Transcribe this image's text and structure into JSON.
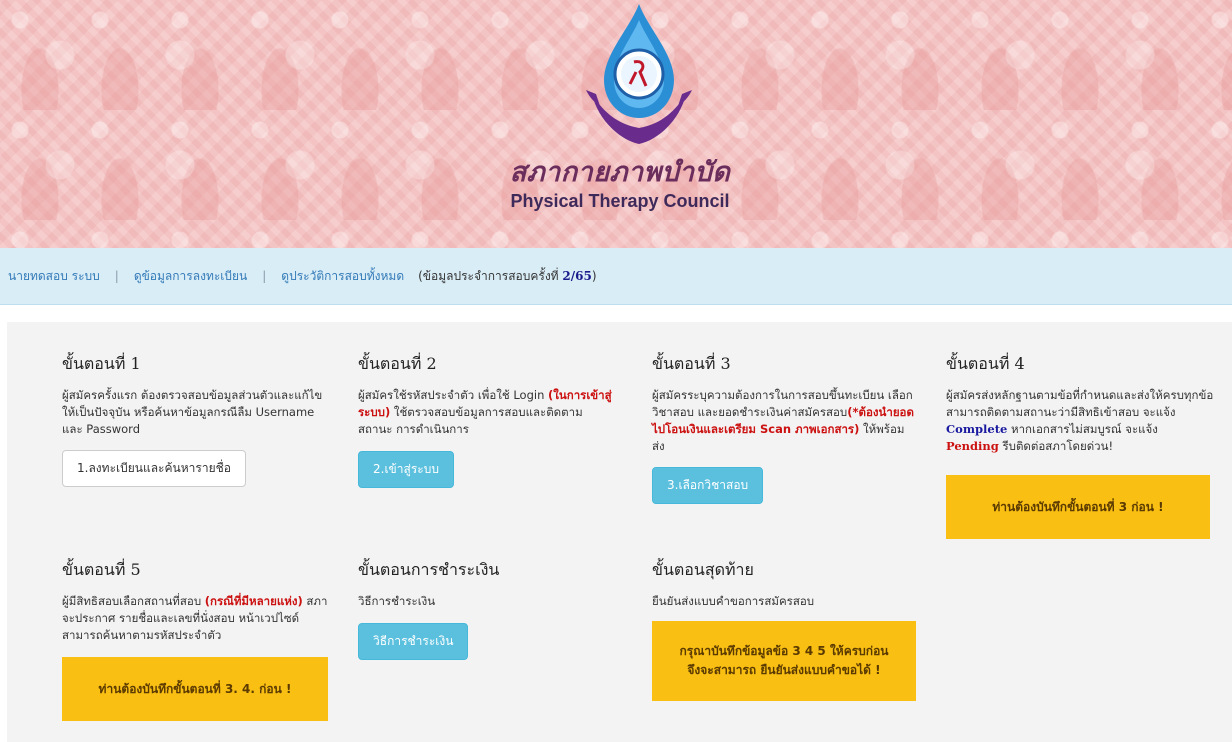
{
  "header": {
    "org_thai": "สภากายภาพบำบัด",
    "org_en": "Physical Therapy Council",
    "logo_text": "สภากายภาพบำบัด Physical Therapy Council"
  },
  "nav": {
    "items": [
      "นายทดสอบ ระบบ",
      "ดูข้อมูลการลงทะเบียน",
      "ดูประวัติการสอบทั้งหมด"
    ],
    "exam_info_prefix": "(ข้อมูลประจำการสอบครั้งที่",
    "exam_round": "2/65",
    "exam_info_suffix": ")"
  },
  "steps": {
    "s1": {
      "title": "ขั้นตอนที่ 1",
      "desc": "ผู้สมัครครั้งแรก ต้องตรวจสอบข้อมูลส่วนตัวและแก้ไขให้เป็นปัจจุบัน หรือค้นหาข้อมูลกรณีลืม Username และ Password",
      "button": "1.ลงทะเบียนและค้นหารายชื่อ"
    },
    "s2": {
      "title": "ขั้นตอนที่ 2",
      "desc_a": "ผู้สมัครใช้รหัสประจำตัว เพื่อใช้ Login ",
      "desc_red": "(ในการเข้าสู่ระบบ)",
      "desc_b": " ใช้ตรวจสอบข้อมูลการสอบและติดตามสถานะ การดำเนินการ",
      "button": "2.เข้าสู่ระบบ"
    },
    "s3": {
      "title": "ขั้นตอนที่ 3",
      "desc_a": "ผู้สมัครระบุความต้องการในการสอบขึ้นทะเบียน เลือกวิชาสอบ และยอดชำระเงินค่าสมัครสอบ",
      "desc_red": "(*ต้องนำยอดไปโอนเงินและเตรียม Scan ภาพเอกสาร)",
      "desc_b": " ให้พร้อมส่ง",
      "button": "3.เลือกวิชาสอบ"
    },
    "s4": {
      "title": "ขั้นตอนที่ 4",
      "desc_a": "ผู้สมัครส่งหลักฐานตามข้อที่กำหนดและส่งให้ครบทุกข้อ สามารถติดตามสถานะว่ามีสิทธิเข้าสอบ จะแจ้ง ",
      "desc_complete": "Complete",
      "desc_b": " หากเอกสารไม่สมบูรณ์ จะแจ้ง ",
      "desc_pending": "Pending",
      "desc_c": " รีบติดต่อสภาโดยด่วน!",
      "warning": "ท่านต้องบันทึกขั้นตอนที่ 3 ก่อน !"
    },
    "s5": {
      "title": "ขั้นตอนที่ 5",
      "desc_a": "ผู้มีสิทธิสอบเลือกสถานที่สอบ ",
      "desc_red": "(กรณีที่มีหลายแห่ง)",
      "desc_b": " สภาจะประกาศ รายชื่อและเลขที่นั่งสอบ หน้าเวปไซด์ สามารถค้นหาตามรหัสประจำตัว",
      "warning": "ท่านต้องบันทึกขั้นตอนที่ 3. 4. ก่อน !"
    },
    "payment": {
      "title": "ขั้นตอนการชำระเงิน",
      "desc": "วิธีการชำระเงิน",
      "button": "วิธีการชำระเงิน"
    },
    "final": {
      "title": "ขั้นตอนสุดท้าย",
      "desc": "ยืนยันส่งแบบคำขอการสมัครสอบ",
      "warning_line1": "กรุณาบันทึกข้อมูลข้อ 3 4 5 ให้ครบก่อน",
      "warning_line2": "จึงจะสามารถ ยืนยันส่งแบบคำขอได้ !"
    }
  },
  "colors": {
    "banner": "#f4c3c3",
    "navbar": "#d9edf7",
    "link": "#337ab7",
    "info_button": "#5bc0de",
    "warning": "#f9bf13",
    "alert_red": "#cc1111"
  }
}
